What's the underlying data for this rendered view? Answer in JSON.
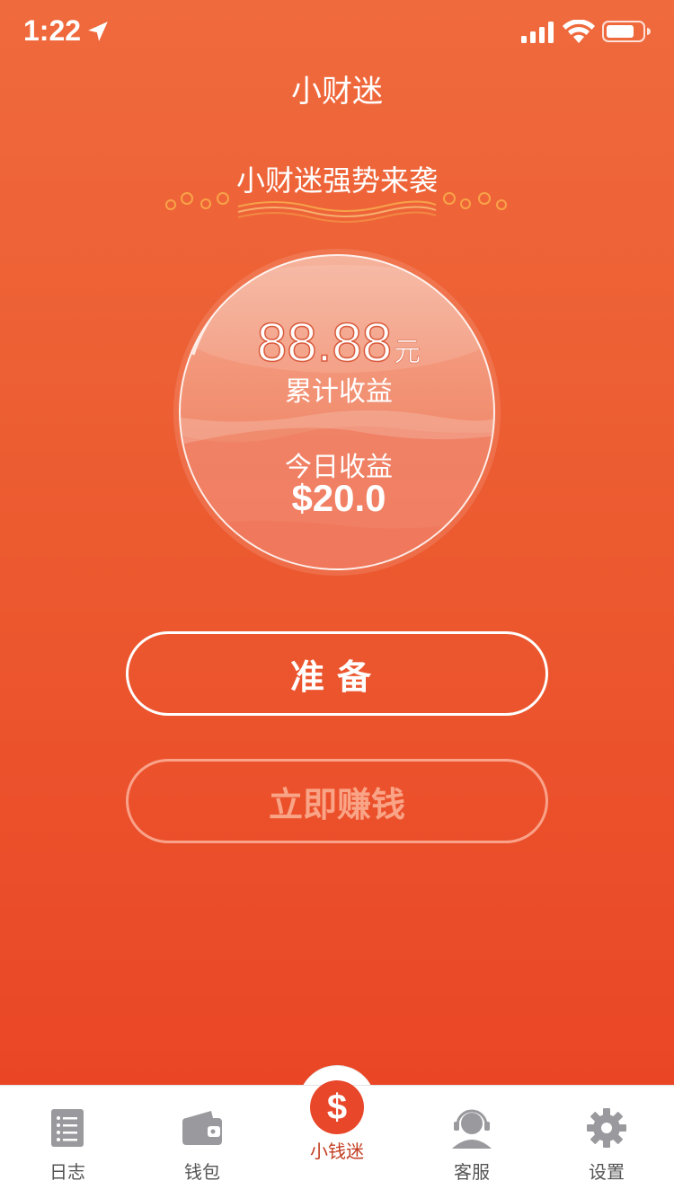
{
  "status_bar": {
    "time": "1:22"
  },
  "nav": {
    "title": "小财迷"
  },
  "promo": {
    "title": "小财迷强势来袭"
  },
  "earnings": {
    "total_amount": "88.88",
    "total_unit": "元",
    "total_label": "累计收益",
    "today_label": "今日收益",
    "today_amount": "$20.0"
  },
  "buttons": {
    "prepare_label": "准备",
    "earn_label": "立即赚钱"
  },
  "tabbar": {
    "active_index": 2,
    "items": [
      {
        "label": "日志",
        "icon": "list-icon"
      },
      {
        "label": "钱包",
        "icon": "wallet-icon"
      },
      {
        "label": "小钱迷",
        "icon": "dollar-icon"
      },
      {
        "label": "客服",
        "icon": "customer-service-icon"
      },
      {
        "label": "设置",
        "icon": "gear-icon"
      }
    ]
  },
  "colors": {
    "background_top": "#ef6a3d",
    "background_bottom": "#e94224",
    "accent": "#e8472a",
    "tab_inactive": "#8e8e93"
  }
}
